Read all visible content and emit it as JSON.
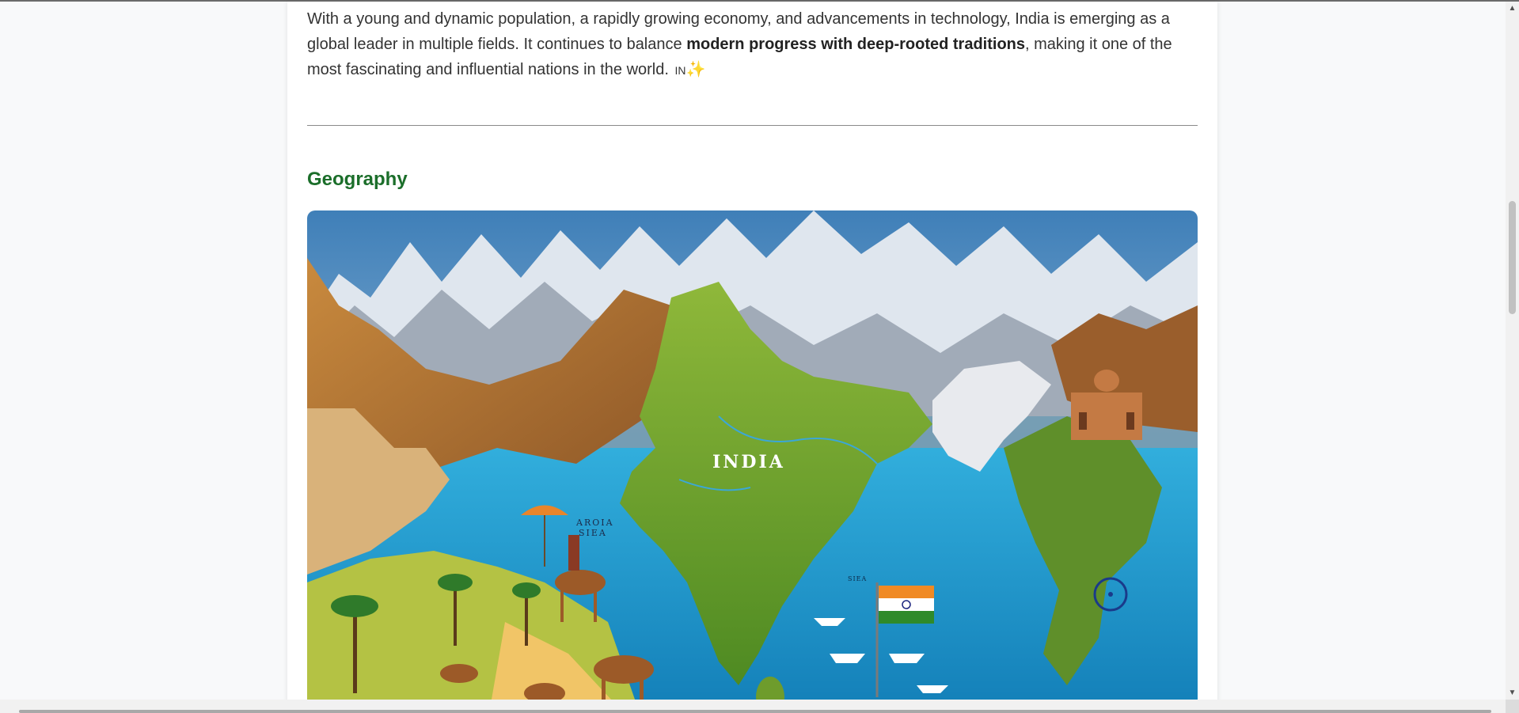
{
  "article": {
    "intro": {
      "part1": "With a young and dynamic population, a rapidly growing economy, and advancements in technology, India is emerging as a global leader in multiple fields. It continues to balance ",
      "bold": "modern progress with deep-rooted traditions",
      "part2": ", making it one of the most fascinating and influential nations in the world. ",
      "flag_code": "IN",
      "emoji": "✨"
    },
    "geography": {
      "title": "Geography",
      "map_labels": {
        "country": "INDIA",
        "sea_line1": "AROIA",
        "sea_line2": "SIEA",
        "bay": "SIEA"
      }
    }
  },
  "scrollbar": {
    "up_arrow": "▲",
    "down_arrow": "▼"
  },
  "colors": {
    "heading": "#1b6e2a",
    "body_text": "#333333",
    "divider": "#8a8a8a",
    "ocean": "#1fa3d8",
    "land": "#7aa82d",
    "mountain": "#8a5a2b"
  }
}
